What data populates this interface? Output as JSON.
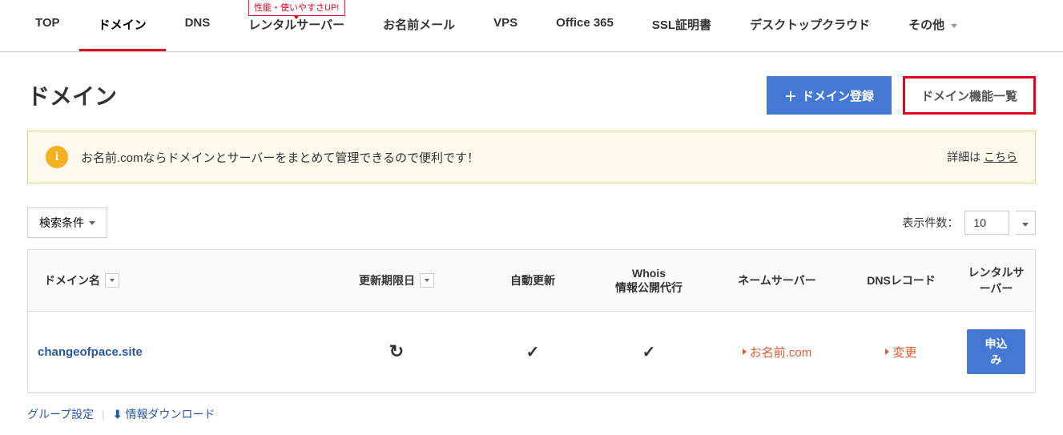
{
  "nav": {
    "items": [
      {
        "label": "TOP"
      },
      {
        "label": "ドメイン",
        "active": true
      },
      {
        "label": "DNS"
      },
      {
        "label": "レンタルサーバー",
        "badge": "性能・使いやすさUP!"
      },
      {
        "label": "お名前メール"
      },
      {
        "label": "VPS"
      },
      {
        "label": "Office 365"
      },
      {
        "label": "SSL証明書"
      },
      {
        "label": "デスクトップクラウド"
      },
      {
        "label": "その他",
        "dropdown": true
      }
    ]
  },
  "page_title": "ドメイン",
  "header_buttons": {
    "register": "ドメイン登録",
    "features": "ドメイン機能一覧"
  },
  "info": {
    "text": "お名前.comならドメインとサーバーをまとめて管理できるので便利です！",
    "link_prefix": "詳細は ",
    "link_label": "こちら"
  },
  "controls": {
    "search": "検索条件",
    "display_label": "表示件数：",
    "display_value": "10"
  },
  "table": {
    "headers": {
      "domain": "ドメイン名",
      "expiry": "更新期限日",
      "auto": "自動更新",
      "whois_line1": "Whois",
      "whois_line2": "情報公開代行",
      "ns": "ネームサーバー",
      "dns": "DNSレコード",
      "server": "レンタルサーバー"
    },
    "rows": [
      {
        "domain": "changeofpace.site",
        "expiry": "",
        "auto": "✓",
        "whois": "✓",
        "ns": "お名前.com",
        "dns": "変更",
        "server": "申込み"
      }
    ]
  },
  "footer": {
    "group_settings": "グループ設定",
    "download": "情報ダウンロード"
  }
}
